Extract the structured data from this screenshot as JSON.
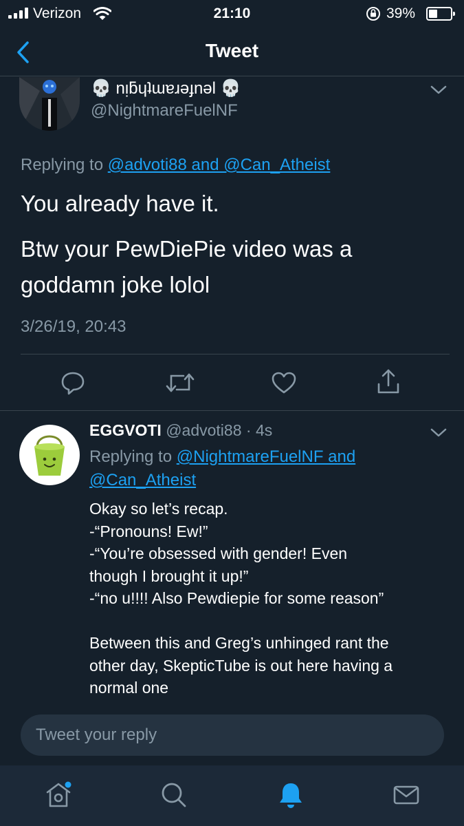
{
  "status_bar": {
    "carrier": "Verizon",
    "time": "21:10",
    "battery": "39%",
    "battery_level": 0.39
  },
  "nav": {
    "title": "Tweet",
    "back_icon": "chevron-left-icon"
  },
  "main_tweet": {
    "display_name": "💀 nᴉƃɥʇɯɐɹǝɟnǝl 💀",
    "handle": "@NightmareFuelNF",
    "replying_prefix": "Replying to ",
    "replying_to": "@advoti88 and @Can_Atheist",
    "text_line1": "You already have it.",
    "text_line2": "Btw your PewDiePie video was a",
    "text_line3": "goddamn joke lolol",
    "timestamp": "3/26/19, 20:43",
    "actions": [
      "reply-icon",
      "retweet-icon",
      "like-icon",
      "share-icon"
    ]
  },
  "reply_tweet": {
    "display_name": "EGGVOTI",
    "handle": "@advoti88",
    "age": " · 4s",
    "replying_prefix": "Replying to ",
    "replying_to_1": "@NightmareFuelNF and",
    "replying_to_2": "@Can_Atheist",
    "lines": [
      "Okay so let’s recap.",
      "-“Pronouns! Ew!”",
      "-“You’re obsessed with gender! Even",
      "though I brought it up!”",
      "-“no u!!!! Also Pewdiepie for some reason”",
      "",
      "Between this and Greg’s unhinged rant the",
      "other day, SkepticTube is out here having a",
      "normal one"
    ]
  },
  "reply_box": {
    "placeholder": "Tweet your reply"
  },
  "tab_bar": {
    "items": [
      "home-icon",
      "search-icon",
      "notifications-icon",
      "messages-icon"
    ],
    "active": "notifications-icon"
  },
  "colors": {
    "background": "#15202b",
    "accent": "#1da1f2",
    "secondary_text": "#8899a6"
  }
}
